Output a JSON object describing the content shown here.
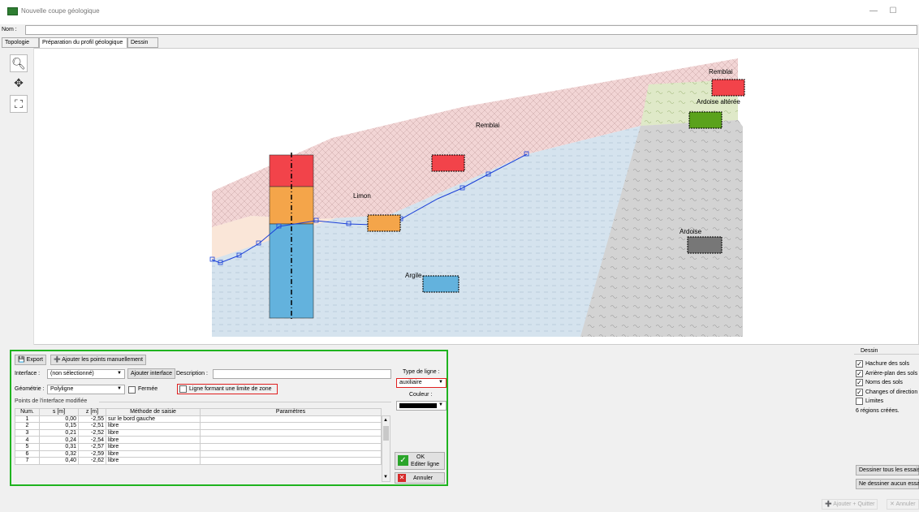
{
  "window": {
    "title": "Nouvelle coupe géologique",
    "min": "—",
    "max": "☐"
  },
  "name_row": {
    "label": "Nom :",
    "value": ""
  },
  "tabs": [
    {
      "label": "Topologie"
    },
    {
      "label": "Préparation du profil géologique"
    },
    {
      "label": "Dessin"
    }
  ],
  "canvas": {
    "labels": {
      "remblai_main": "Remblai",
      "remblai_right": "Remblai",
      "ardoise_alteree": "Ardoise altérée",
      "limon": "Limon",
      "argile": "Argile",
      "ardoise": "Ardoise"
    },
    "colors": {
      "remblai": "#f2d5d5",
      "limon": "#fae6d8",
      "argile": "#d5e3ee",
      "ardoise": "#d3d3d3",
      "ardoise_alteree": "#dfe9c8",
      "polyline": "#1a3fd8"
    }
  },
  "panel": {
    "export_label": "Export",
    "add_points_label": "Ajouter les points manuellement",
    "interface_label": "Interface :",
    "interface_value": "(non sélectionné)",
    "add_interface_label": "Ajouter interface",
    "description_label": "Description :",
    "description_value": "",
    "geometry_label": "Géométrie :",
    "geometry_value": "Polyligne",
    "closed_label": "Fermée",
    "zone_limit_label": "Ligne formant une limite de zone",
    "points_group_label": "Points de l'interface modifiée",
    "line_type_label": "Type de ligne :",
    "line_type_value": "auxiliaire",
    "color_label": "Couleur :",
    "ok_label": "OK",
    "edit_line_label": "Editer ligne",
    "cancel_label": "Annuler",
    "table": {
      "headers": [
        "Num.",
        "s [m]",
        "z [m]",
        "Méthode de saisie",
        "Paramètres"
      ],
      "rows": [
        [
          "1",
          "0,00",
          "-2,55",
          "sur le bord gauche",
          ""
        ],
        [
          "2",
          "0,15",
          "-2,51",
          "libre",
          ""
        ],
        [
          "3",
          "0,21",
          "-2,52",
          "libre",
          ""
        ],
        [
          "4",
          "0,24",
          "-2,54",
          "libre",
          ""
        ],
        [
          "5",
          "0,31",
          "-2,57",
          "libre",
          ""
        ],
        [
          "6",
          "0,32",
          "-2,59",
          "libre",
          ""
        ],
        [
          "7",
          "0,40",
          "-2,62",
          "libre",
          ""
        ]
      ]
    }
  },
  "drawing": {
    "group_label": "Dessin",
    "options": [
      {
        "label": "Hachure des sols",
        "checked": "✓"
      },
      {
        "label": "Arrière-plan des sols",
        "checked": "✓"
      },
      {
        "label": "Noms des sols",
        "checked": "✓"
      },
      {
        "label": "Changes of direction",
        "checked": "✓"
      },
      {
        "label": "Limites",
        "checked": ""
      }
    ],
    "regions_text": "6 régions créées.",
    "draw_all_label": "Dessiner tous les essais",
    "draw_none_label": "Ne dessiner aucun essai"
  },
  "status": {
    "add_quit_label": "Ajouter + Quitter",
    "cancel_label": "Annuler"
  }
}
